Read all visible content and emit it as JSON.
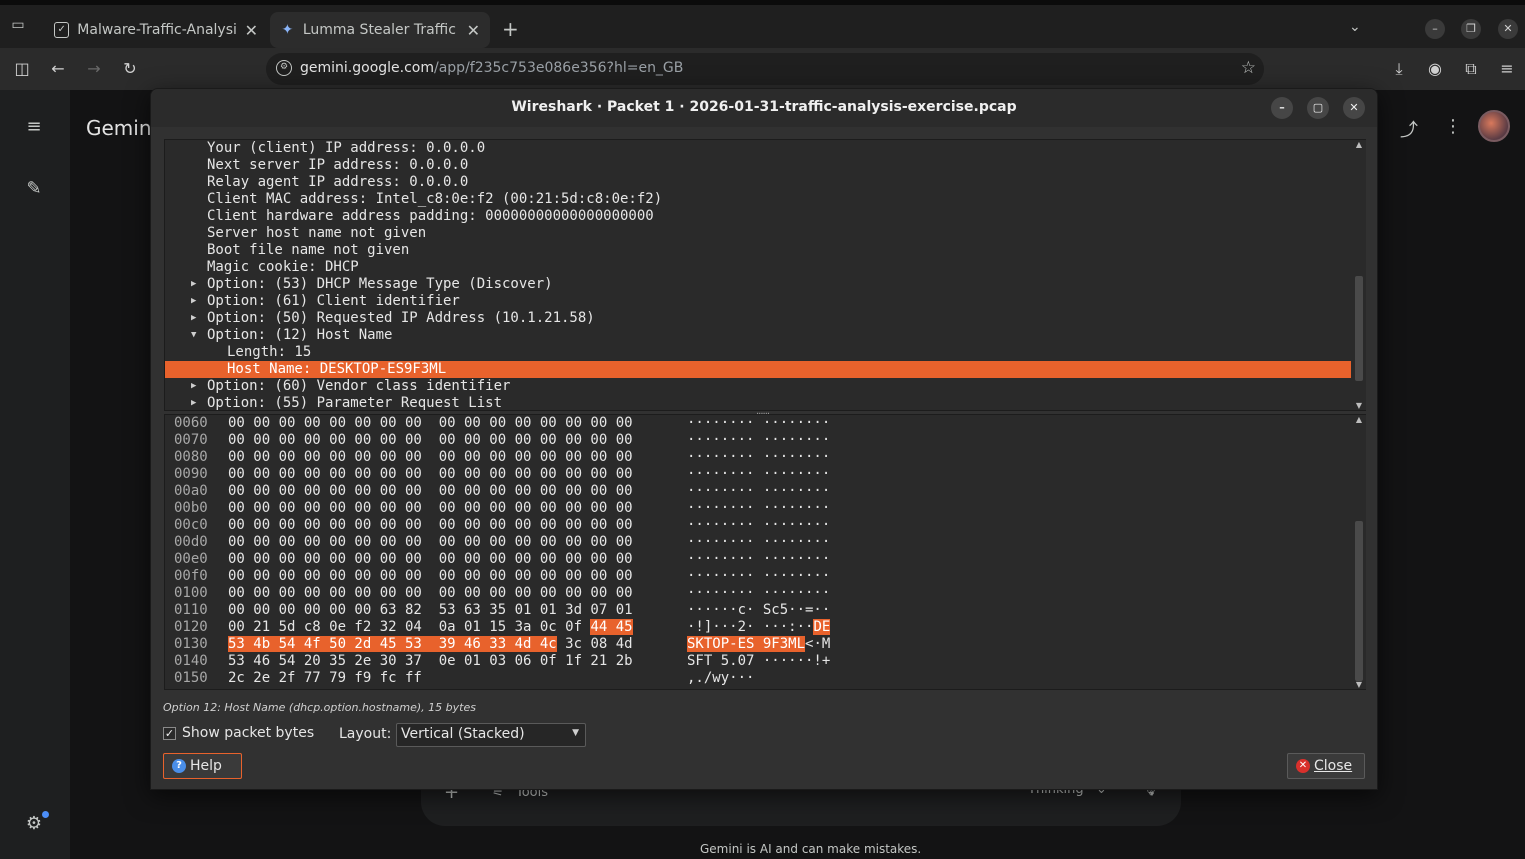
{
  "browser": {
    "tabs": [
      {
        "title": "Malware-Traffic-Analysis.n",
        "active": false
      },
      {
        "title": "Lumma Stealer Traffic An",
        "active": true
      }
    ],
    "url_host": "gemini.google.com",
    "url_path": "/app/f235c753e086e356?hl=en_GB"
  },
  "gemini": {
    "title": "Gemini",
    "tools_label": "Tools",
    "mode_label": "Thinking",
    "disclaimer": "Gemini is AI and can make mistakes."
  },
  "wireshark": {
    "title": "Wireshark · Packet 1 · 2026-01-31-traffic-analysis-exercise.pcap",
    "tree": [
      {
        "text": "Your (client) IP address: 0.0.0.0",
        "indent": 1,
        "arrow": ""
      },
      {
        "text": "Next server IP address: 0.0.0.0",
        "indent": 1,
        "arrow": ""
      },
      {
        "text": "Relay agent IP address: 0.0.0.0",
        "indent": 1,
        "arrow": ""
      },
      {
        "text": "Client MAC address: Intel_c8:0e:f2 (00:21:5d:c8:0e:f2)",
        "indent": 1,
        "arrow": ""
      },
      {
        "text": "Client hardware address padding: 00000000000000000000",
        "indent": 1,
        "arrow": ""
      },
      {
        "text": "Server host name not given",
        "indent": 1,
        "arrow": ""
      },
      {
        "text": "Boot file name not given",
        "indent": 1,
        "arrow": ""
      },
      {
        "text": "Magic cookie: DHCP",
        "indent": 1,
        "arrow": ""
      },
      {
        "text": "Option: (53) DHCP Message Type (Discover)",
        "indent": 1,
        "arrow": "right"
      },
      {
        "text": "Option: (61) Client identifier",
        "indent": 1,
        "arrow": "right"
      },
      {
        "text": "Option: (50) Requested IP Address (10.1.21.58)",
        "indent": 1,
        "arrow": "right"
      },
      {
        "text": "Option: (12) Host Name",
        "indent": 1,
        "arrow": "down"
      },
      {
        "text": "Length: 15",
        "indent": 2,
        "arrow": ""
      },
      {
        "text": "Host Name: DESKTOP-ES9F3ML",
        "indent": 2,
        "arrow": "",
        "selected": true
      },
      {
        "text": "Option: (60) Vendor class identifier",
        "indent": 1,
        "arrow": "right"
      },
      {
        "text": "Option: (55) Parameter Request List",
        "indent": 1,
        "arrow": "right"
      }
    ],
    "bytes": [
      {
        "off": "0060",
        "hex": "00 00 00 00 00 00 00 00  00 00 00 00 00 00 00 00",
        "asc": "········ ········"
      },
      {
        "off": "0070",
        "hex": "00 00 00 00 00 00 00 00  00 00 00 00 00 00 00 00",
        "asc": "········ ········"
      },
      {
        "off": "0080",
        "hex": "00 00 00 00 00 00 00 00  00 00 00 00 00 00 00 00",
        "asc": "········ ········"
      },
      {
        "off": "0090",
        "hex": "00 00 00 00 00 00 00 00  00 00 00 00 00 00 00 00",
        "asc": "········ ········"
      },
      {
        "off": "00a0",
        "hex": "00 00 00 00 00 00 00 00  00 00 00 00 00 00 00 00",
        "asc": "········ ········"
      },
      {
        "off": "00b0",
        "hex": "00 00 00 00 00 00 00 00  00 00 00 00 00 00 00 00",
        "asc": "········ ········"
      },
      {
        "off": "00c0",
        "hex": "00 00 00 00 00 00 00 00  00 00 00 00 00 00 00 00",
        "asc": "········ ········"
      },
      {
        "off": "00d0",
        "hex": "00 00 00 00 00 00 00 00  00 00 00 00 00 00 00 00",
        "asc": "········ ········"
      },
      {
        "off": "00e0",
        "hex": "00 00 00 00 00 00 00 00  00 00 00 00 00 00 00 00",
        "asc": "········ ········"
      },
      {
        "off": "00f0",
        "hex": "00 00 00 00 00 00 00 00  00 00 00 00 00 00 00 00",
        "asc": "········ ········"
      },
      {
        "off": "0100",
        "hex": "00 00 00 00 00 00 00 00  00 00 00 00 00 00 00 00",
        "asc": "········ ········"
      },
      {
        "off": "0110",
        "hex": "00 00 00 00 00 00 63 82  53 63 35 01 01 3d 07 01",
        "asc": "······c· Sc5··=··"
      },
      {
        "off": "0120",
        "hex_pre": "00 21 5d c8 0e f2 32 04  0a 01 15 3a 0c 0f ",
        "hex_hl": "44 45",
        "hex_post": "",
        "asc_pre": "·!]···2· ···:··",
        "asc_hl": "DE",
        "asc_post": ""
      },
      {
        "off": "0130",
        "hex_pre": "",
        "hex_hl": "53 4b 54 4f 50 2d 45 53  39 46 33 4d 4c",
        "hex_post": " 3c 08 4d",
        "asc_pre": "",
        "asc_hl": "SKTOP-ES 9F3ML",
        "asc_post": "<·M"
      },
      {
        "off": "0140",
        "hex": "53 46 54 20 35 2e 30 37  0e 01 03 06 0f 1f 21 2b",
        "asc": "SFT 5.07 ······!+"
      },
      {
        "off": "0150",
        "hex": "2c 2e 2f 77 79 f9 fc ff",
        "asc": ",./wy···"
      }
    ],
    "status": "Option 12: Host Name (dhcp.option.hostname), 15 bytes",
    "show_bytes_label": "Show packet bytes",
    "show_bytes_checked": true,
    "layout_label": "Layout:",
    "layout_value": "Vertical (Stacked)",
    "help_label": "Help",
    "close_label": "Close"
  },
  "colors": {
    "accent": "#e8622c"
  }
}
